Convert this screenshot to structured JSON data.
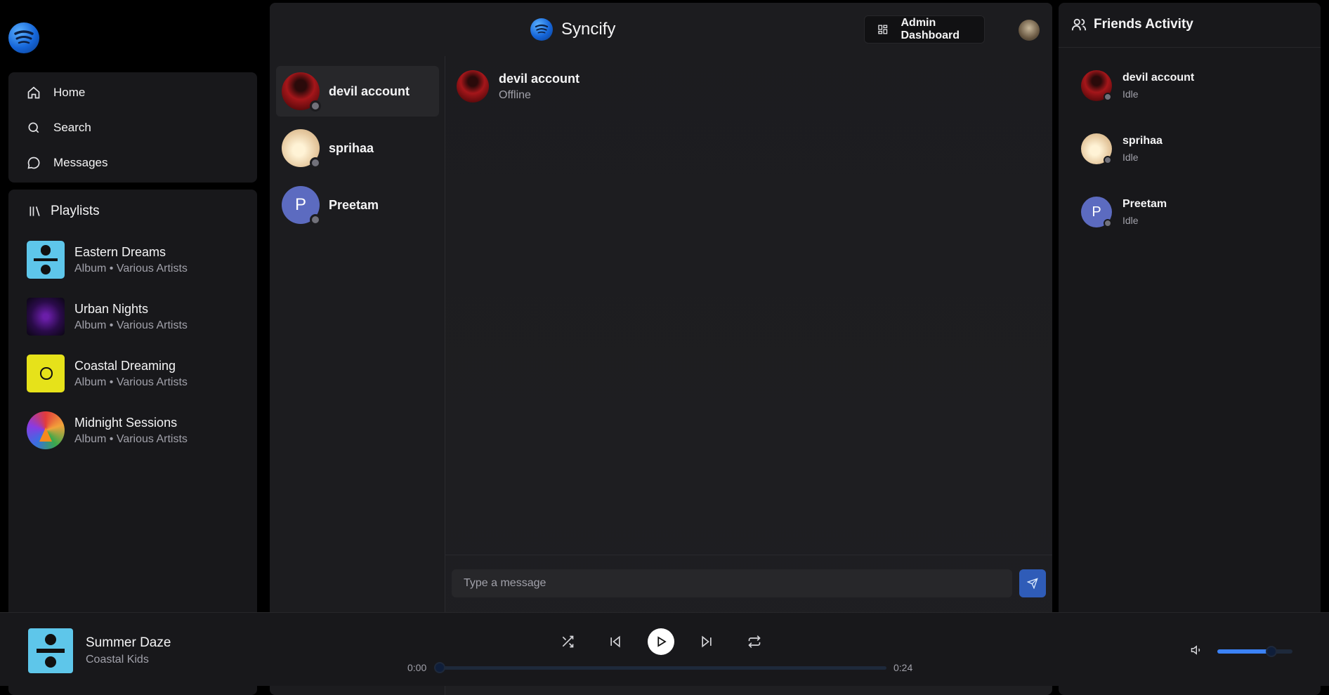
{
  "app": {
    "name": "Syncify"
  },
  "sidebar": {
    "nav": [
      {
        "label": "Home",
        "icon": "home-icon"
      },
      {
        "label": "Search",
        "icon": "search-icon"
      },
      {
        "label": "Messages",
        "icon": "message-icon"
      }
    ],
    "playlists_header": "Playlists",
    "playlists": [
      {
        "title": "Eastern Dreams",
        "subtitle": "Album • Various Artists"
      },
      {
        "title": "Urban Nights",
        "subtitle": "Album • Various Artists"
      },
      {
        "title": "Coastal Dreaming",
        "subtitle": "Album • Various Artists"
      },
      {
        "title": "Midnight Sessions",
        "subtitle": "Album • Various Artists"
      }
    ]
  },
  "header": {
    "admin_button": "Admin Dashboard"
  },
  "contacts": [
    {
      "name": "devil account",
      "status": "offline"
    },
    {
      "name": "sprihaa",
      "status": "offline"
    },
    {
      "name": "Preetam",
      "initial": "P",
      "status": "offline"
    }
  ],
  "chat": {
    "name": "devil account",
    "status": "Offline",
    "input_placeholder": "Type a message"
  },
  "friends_activity": {
    "title": "Friends Activity",
    "friends": [
      {
        "name": "devil account",
        "status": "Idle"
      },
      {
        "name": "sprihaa",
        "status": "Idle"
      },
      {
        "name": "Preetam",
        "initial": "P",
        "status": "Idle"
      }
    ]
  },
  "player": {
    "title": "Summer Daze",
    "artist": "Coastal Kids",
    "current_time": "0:00",
    "duration": "0:24",
    "progress": 0,
    "volume": 0.72
  },
  "colors": {
    "accent": "#3b82f6",
    "send_button": "#2f5cb8",
    "panel": "#18181b"
  }
}
